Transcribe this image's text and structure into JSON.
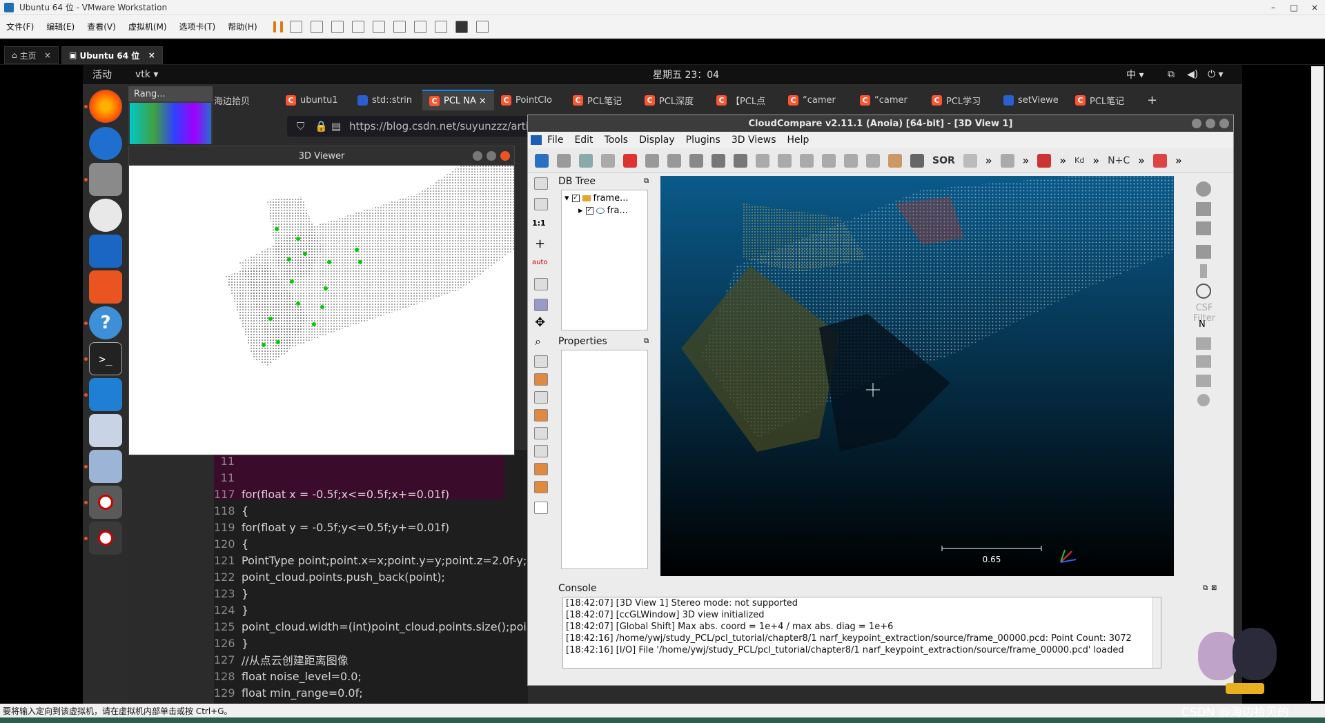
{
  "vmware": {
    "title": "Ubuntu 64 位 - VMware Workstation",
    "menu": [
      "文件(F)",
      "编辑(E)",
      "查看(V)",
      "虚拟机(M)",
      "选项卡(T)",
      "帮助(H)"
    ],
    "tabs": [
      {
        "label": "主页"
      },
      {
        "label": "Ubuntu 64 位"
      }
    ],
    "status_text": "要将输入定向到该虚拟机，请在虚拟机内部单击或按 Ctrl+G。",
    "win_min": "–",
    "win_max": "□",
    "win_close": "×"
  },
  "gnome": {
    "activities": "活动",
    "app": "vtk ▾",
    "clock": "星期五 23：04",
    "input_method": "中 ▾"
  },
  "firefox": {
    "url": "https://blog.csdn.net/suyunzzz/arti",
    "tabs": [
      {
        "label": "海边拾贝"
      },
      {
        "label": "ubuntu1"
      },
      {
        "label": "std::strin"
      },
      {
        "label": "PCL NA"
      },
      {
        "label": "PointClo"
      },
      {
        "label": "PCL笔记"
      },
      {
        "label": "PCL深度"
      },
      {
        "label": "【PCL点"
      },
      {
        "label": "“camer"
      },
      {
        "label": "“camer"
      },
      {
        "label": "PCL学习"
      },
      {
        "label": "setViewe"
      },
      {
        "label": "PCL笔记"
      }
    ],
    "csdn_glyph": "C",
    "new_tab": "+"
  },
  "code": {
    "lines": [
      {
        "ln": "11",
        "text": ""
      },
      {
        "ln": "11",
        "text": ""
      },
      {
        "ln": "117",
        "text": "for(float x = -0.5f;x<=0.5f;x+=0.01f)"
      },
      {
        "ln": "118",
        "text": "{"
      },
      {
        "ln": "119",
        "text": "for(float y = -0.5f;y<=0.5f;y+=0.01f)"
      },
      {
        "ln": "120",
        "text": "{"
      },
      {
        "ln": "121",
        "text": "PointType point;point.x=x;point.y=y;point.z=2.0f-y;"
      },
      {
        "ln": "122",
        "text": "point_cloud.points.push_back(point);"
      },
      {
        "ln": "123",
        "text": "}"
      },
      {
        "ln": "124",
        "text": "}"
      },
      {
        "ln": "125",
        "text": "point_cloud.width=(int)point_cloud.points.size();point_c"
      },
      {
        "ln": "126",
        "text": "}"
      },
      {
        "ln": "127",
        "text": "//从点云创建距离图像"
      },
      {
        "ln": "128",
        "text": "float noise_level=0.0;"
      },
      {
        "ln": "129",
        "text": "float min_range=0.0f;"
      }
    ]
  },
  "rang_window": {
    "title": "Rang..."
  },
  "viewer": {
    "title": "3D Viewer"
  },
  "cloudcompare": {
    "title": "CloudCompare v2.11.1 (Anoia) [64-bit] - [3D View 1]",
    "menu": [
      "File",
      "Edit",
      "Tools",
      "Display",
      "Plugins",
      "3D Views",
      "Help"
    ],
    "db_tree": {
      "title": "DB Tree",
      "items": [
        {
          "label": "frame..."
        },
        {
          "label": "fra..."
        }
      ]
    },
    "properties_title": "Properties",
    "console_title": "Console",
    "console_lines": [
      "[18:42:07] [3D View 1] Stereo mode: not supported",
      "[18:42:07] [ccGLWindow] 3D view initialized",
      "[18:42:07] [Global Shift] Max abs. coord = 1e+4 / max abs. diag = 1e+6",
      "[18:42:16] /home/ywj/study_PCL/pcl_tutorial/chapter8/1 narf_keypoint_extraction/source/frame_00000.pcd: Point Count: 3072",
      "[18:42:16] [I/O] File '/home/ywj/study_PCL/pcl_tutorial/chapter8/1 narf_keypoint_extraction/source/frame_00000.pcd' loaded"
    ],
    "scale_label": "0.65",
    "csf_filter": "CSF Filter",
    "tool_sor": "SOR",
    "tool_nc": "N+C",
    "tool_kd": "Kd",
    "left_1to1": "1:1",
    "left_auto": "auto",
    "north_label": "N",
    "more": "»"
  },
  "watermark": "CSDN @海边拾贝的",
  "colors": {
    "accent": "#0a84ff",
    "ubuntu_orange": "#e95420",
    "csdn_red": "#fc5531",
    "cc_bg_top": "#0a5a8a",
    "cc_bg_bottom": "#000000"
  }
}
